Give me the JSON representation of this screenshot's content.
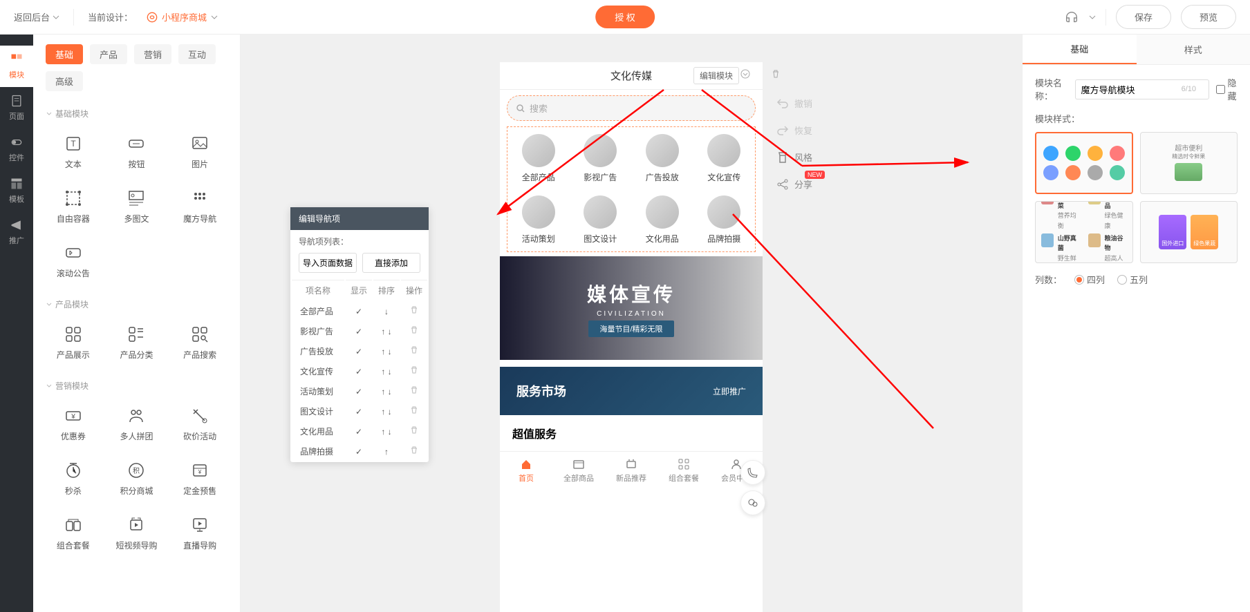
{
  "topbar": {
    "back": "返回后台",
    "design_label": "当前设计：",
    "design_name": "小程序商城",
    "auth": "授 权",
    "save": "保存",
    "preview": "预览"
  },
  "darkSidebar": [
    {
      "label": "模块",
      "active": true
    },
    {
      "label": "页面"
    },
    {
      "label": "控件"
    },
    {
      "label": "模板"
    },
    {
      "label": "推广"
    }
  ],
  "moduleTabs": {
    "row1": [
      "基础",
      "产品",
      "营销",
      "互动"
    ],
    "row2": [
      "高级"
    ],
    "activeIndex": 0
  },
  "moduleSections": [
    {
      "title": "基础模块",
      "items": [
        "文本",
        "按钮",
        "图片",
        "自由容器",
        "多图文",
        "魔方导航",
        "滚动公告"
      ]
    },
    {
      "title": "产品模块",
      "items": [
        "产品展示",
        "产品分类",
        "产品搜索"
      ]
    },
    {
      "title": "营销模块",
      "items": [
        "优惠券",
        "多人拼团",
        "砍价活动",
        "秒杀",
        "积分商城",
        "定金预售",
        "组合套餐",
        "短视频导购",
        "直播导购"
      ]
    }
  ],
  "phone": {
    "title": "文化传媒",
    "edit_module": "编辑模块",
    "search_placeholder": "搜索",
    "nav": [
      "全部产品",
      "影视广告",
      "广告投放",
      "文化宣传",
      "活动策划",
      "图文设计",
      "文化用品",
      "品牌拍摄"
    ],
    "banner": {
      "big": "媒体宣传",
      "sub": "CIVILIZATION",
      "bar": "海量节目/精彩无限"
    },
    "service": {
      "title": "服务市场",
      "cta": "立即推广"
    },
    "value": "超值服务",
    "tabs": [
      "首页",
      "全部商品",
      "新品推荐",
      "组合套餐",
      "会员中心"
    ],
    "activeTab": 0
  },
  "canvasTools": [
    {
      "label": "撤销",
      "disabled": true
    },
    {
      "label": "恢复",
      "disabled": true
    },
    {
      "label": "风格"
    },
    {
      "label": "分享",
      "new": true
    }
  ],
  "navEditor": {
    "title": "编辑导航项",
    "sub": "导航项列表：",
    "btn_import": "导入页面数据",
    "btn_add": "直接添加",
    "cols": [
      "项名称",
      "显示",
      "排序",
      "操作"
    ],
    "rows": [
      "全部产品",
      "影视广告",
      "广告投放",
      "文化宣传",
      "活动策划",
      "图文设计",
      "文化用品",
      "品牌拍摄"
    ]
  },
  "rightPanel": {
    "tabs": [
      "基础",
      "样式"
    ],
    "activeTab": 0,
    "name_label": "模块名称：",
    "name_value": "魔方导航模块",
    "name_count": "6/10",
    "hide_label": "隐藏",
    "style_label": "模块样式：",
    "cols_label": "列数：",
    "col_options": [
      "四列",
      "五列"
    ],
    "col_selected": 0
  }
}
